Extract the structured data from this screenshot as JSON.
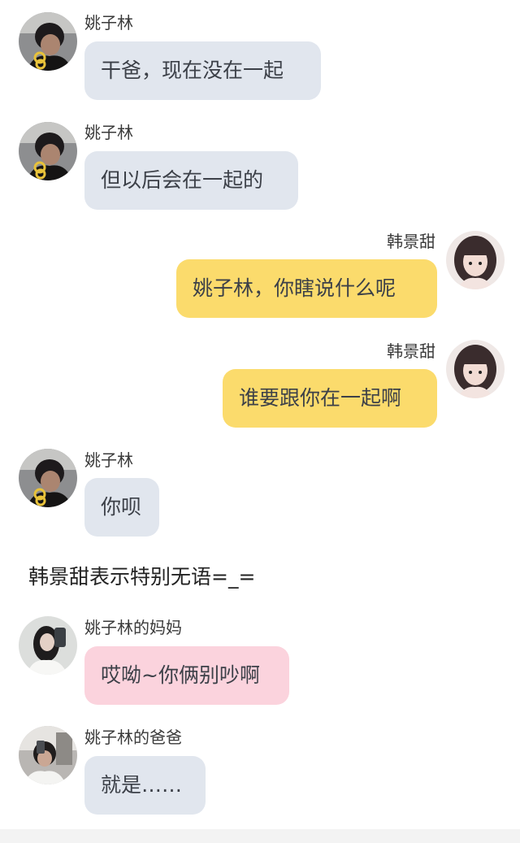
{
  "colors": {
    "bubble_gray": "#e1e6ee",
    "bubble_yellow": "#fbdb6c",
    "bubble_pink": "#fbd3dd"
  },
  "messages": [
    {
      "sender": "姚子林",
      "text": "干爸，现在没在一起",
      "style": "gray",
      "align": "left",
      "avatar": "boy-avatar"
    },
    {
      "sender": "姚子林",
      "text": "但以后会在一起的",
      "style": "gray",
      "align": "left",
      "avatar": "boy-avatar"
    },
    {
      "sender": "韩景甜",
      "text": "姚子林，你瞎说什么呢",
      "style": "yellow",
      "align": "right",
      "avatar": "girl-avatar"
    },
    {
      "sender": "韩景甜",
      "text": "谁要跟你在一起啊",
      "style": "yellow",
      "align": "right",
      "avatar": "girl-avatar"
    },
    {
      "sender": "姚子林",
      "text": "你呗",
      "style": "gray",
      "align": "left",
      "avatar": "boy-avatar"
    },
    {
      "sender": "姚子林的妈妈",
      "text": "哎呦~你俩别吵啊",
      "style": "pink",
      "align": "left",
      "avatar": "mother-avatar"
    },
    {
      "sender": "姚子林的爸爸",
      "text": "就是……",
      "style": "gray",
      "align": "left",
      "avatar": "father-avatar"
    }
  ],
  "system_message": "韩景甜表示特别无语=_="
}
